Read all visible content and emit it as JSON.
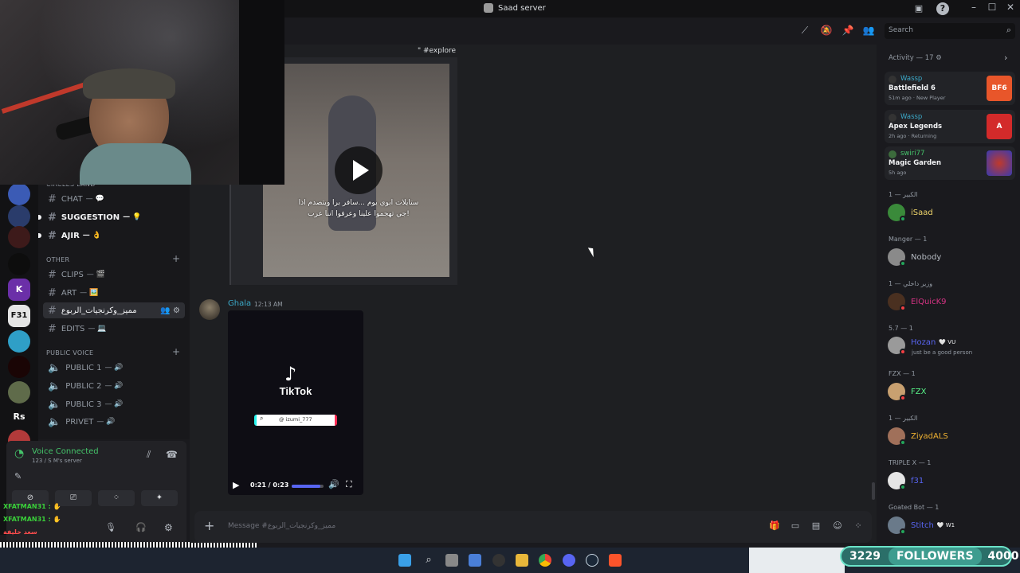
{
  "window": {
    "title": "Saad server"
  },
  "channels": {
    "category_top": "CIRCLES LAND",
    "items_top": [
      {
        "name": "CHAT",
        "tail": "— 💬"
      },
      {
        "name": "SUGGESTION",
        "tail": "— 💡"
      },
      {
        "name": "AJIR",
        "tail": "— 👌"
      }
    ],
    "category_other": "OTHER",
    "items_other": [
      {
        "name": "CLIPS",
        "tail": "— 🎬"
      },
      {
        "name": "ART",
        "tail": "— 🖼️"
      },
      {
        "name": "مميز_وكرنجيات_الربوع",
        "tail": ""
      },
      {
        "name": "EDITS",
        "tail": "— 💻"
      }
    ],
    "category_voice": "PUBLIC VOICE",
    "voice_items": [
      {
        "name": "PUBLIC 1",
        "tail": "— 🔊"
      },
      {
        "name": "PUBLIC 2",
        "tail": "— 🔊"
      },
      {
        "name": "PUBLIC 3",
        "tail": "— 🔊"
      },
      {
        "name": "PRIVET",
        "tail": "— 🔊"
      }
    ]
  },
  "rail": {
    "rs_label": "Rs",
    "f31_label": "F31"
  },
  "voice": {
    "status": "Voice Connected",
    "server": "123 / S M's server"
  },
  "overlay": {
    "line1": "XFATMAN31 : ✋",
    "line2": "XFATMAN31 : ✋",
    "line3": "سعد خليفة"
  },
  "chat": {
    "embed_caption": "\" #explore",
    "video_subtitle1": "ستايلات ابوي يوم ...سافر برا ويتصدم اذا",
    "video_subtitle2": "جي تهجموا علينا وعرفوا اننا عرب!",
    "message2_author": "Ghala",
    "message2_time": "12:13 AM",
    "tiktok_brand": "TikTok",
    "tiktok_handle": "@ izumi_777",
    "video_time": "0:21 / 0:23",
    "video_progress": 0.91,
    "composer_placeholder": "Message #مميز_وكرنجيات_الربوع"
  },
  "members": {
    "search_placeholder": "Search",
    "activity_header": "Activity — 17",
    "activities": [
      {
        "user": "Wassp",
        "game": "Battlefield 6",
        "meta": "51m ago  ·  New Player",
        "thumb": "BF6",
        "thumb_color": "#e8562a"
      },
      {
        "user": "Wassp",
        "game": "Apex Legends",
        "meta": "2h ago  ·  Returning",
        "thumb": "A",
        "thumb_color": "#d32a2a"
      },
      {
        "user": "swiri77",
        "game": "Magic Garden",
        "meta": "5h ago",
        "thumb": "",
        "thumb_color": "#3a3bb0"
      }
    ],
    "groups": [
      {
        "role": "الكبير — 1",
        "name": "iSaad",
        "color": "#f0d66b",
        "sub": ""
      },
      {
        "role": "Manger — 1",
        "name": "Nobody",
        "color": "#b5bac1",
        "sub": ""
      },
      {
        "role": "وزير داخلي — 1",
        "name": "ElQuicK9",
        "color": "#d63384",
        "sub": ""
      },
      {
        "role": "5.7 — 1",
        "name": "Hozan",
        "color": "#5865f2",
        "sub": "just be a good person",
        "tag": "🤍 VU"
      },
      {
        "role": "FZX — 1",
        "name": "FZX",
        "color": "#57f287",
        "sub": ""
      },
      {
        "role": "الكبير — 1",
        "name": "ZiyadALS",
        "color": "#f0b232",
        "sub": ""
      },
      {
        "role": "TRIPLE X — 1",
        "name": "f31",
        "color": "#5865f2",
        "sub": ""
      },
      {
        "role": "Goated Bot — 1",
        "name": "Stitch",
        "color": "#5865f2",
        "sub": "",
        "tag": "🤍 W1"
      }
    ]
  },
  "stream": {
    "followers_count": "3229",
    "followers_label": "FOLLOWERS",
    "followers_goal": "4000"
  },
  "colors": {
    "accent": "#5865f2",
    "online": "#23a55a",
    "voice": "#45c46a"
  }
}
